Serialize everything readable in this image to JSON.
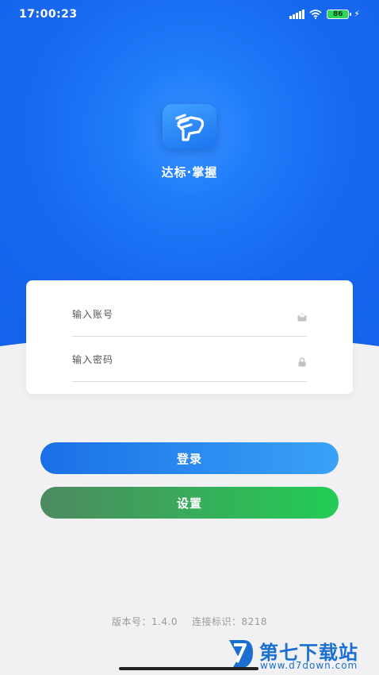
{
  "status_bar": {
    "time": "17:00:23",
    "battery_level": "86",
    "icons": [
      "signal-icon",
      "wifi-icon",
      "battery-icon",
      "charging-icon"
    ]
  },
  "app": {
    "name": "达标·掌握",
    "logo_icon": "fist-logo-icon"
  },
  "form": {
    "account_placeholder": "输入账号",
    "account_value": "",
    "password_placeholder": "输入密码",
    "password_value": "",
    "account_icon": "envelope-icon",
    "password_icon": "lock-icon"
  },
  "buttons": {
    "login_label": "登录",
    "settings_label": "设置"
  },
  "footer": {
    "version_text": "版本号：1.4.0",
    "connection_text": "连接标识：8218"
  },
  "watermark": {
    "title": "第七下载站",
    "url": "www.d7down.com"
  },
  "colors": {
    "primary_blue": "#1767ef",
    "login_gradient_start": "#1a6fe6",
    "login_gradient_end": "#3aa2f7",
    "settings_gradient_start": "#4d8a60",
    "settings_gradient_end": "#23cc55",
    "background": "#f1f1f3"
  }
}
